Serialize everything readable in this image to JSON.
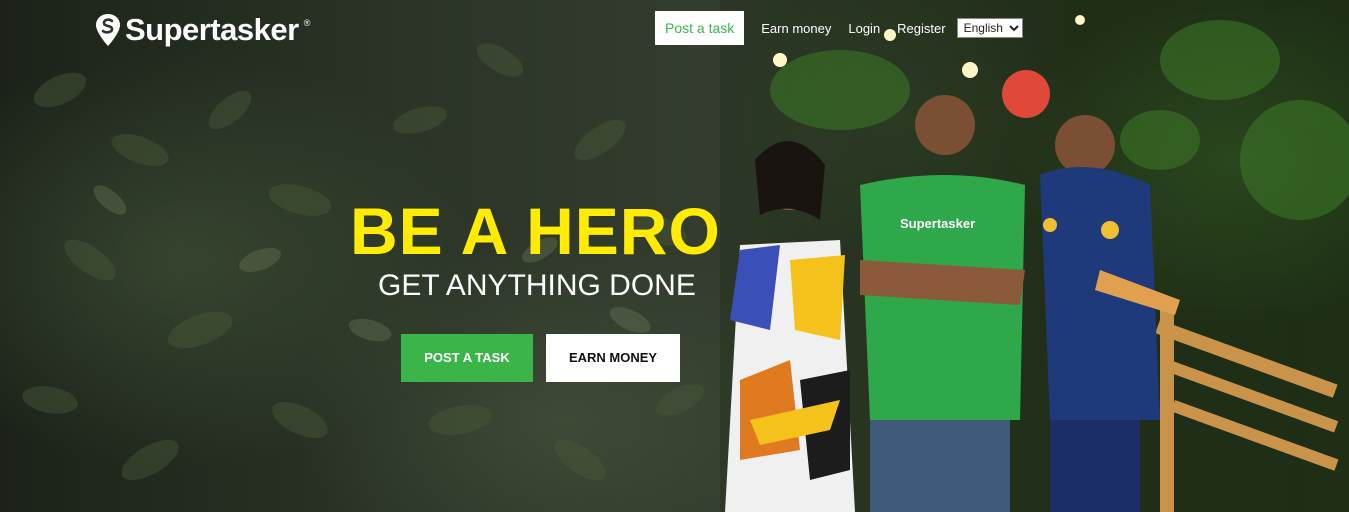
{
  "brand": {
    "name": "Supertasker",
    "registered": "®",
    "shirt_text": "Supertasker"
  },
  "nav": {
    "post_task": "Post a task",
    "earn_money": "Earn money",
    "login": "Login",
    "register": "Register",
    "language": {
      "selected": "English"
    }
  },
  "hero": {
    "headline": "BE A HERO",
    "subheadline": "GET ANYTHING DONE",
    "cta_post": "POST A TASK",
    "cta_earn": "EARN MONEY"
  },
  "colors": {
    "accent_green": "#3bb54a",
    "headline_yellow": "#ffec00"
  }
}
